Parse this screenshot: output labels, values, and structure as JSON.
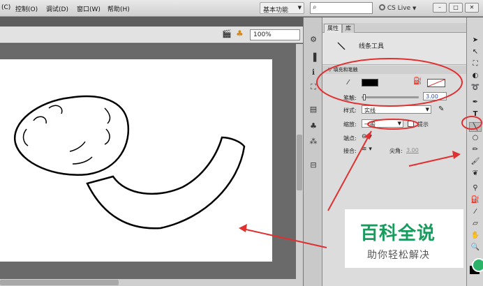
{
  "menubar": {
    "items": [
      "(C)",
      "控制(O)",
      "调试(D)",
      "窗口(W)",
      "帮助(H)"
    ],
    "workspace_label": "基本功能",
    "search_icon": "search-icon",
    "cslive_label": "CS Live",
    "win_buttons": [
      "–",
      "□",
      "✕"
    ]
  },
  "scene": {
    "zoom": "100%"
  },
  "properties": {
    "tabs": [
      "属性",
      "库"
    ],
    "tool_name": "线条工具",
    "section_title": "填充和笔触",
    "stroke_label": "笔触:",
    "stroke_value": "3.00",
    "style_label": "样式:",
    "style_value": "实线",
    "scale_label": "缩放:",
    "scale_value": "一般",
    "hint_label": "提示",
    "cap_label": "端点:",
    "join_label": "接合:",
    "miter_label": "尖角:",
    "miter_value": "3.00"
  },
  "colors": {
    "stroke_color": "#000000",
    "fill_color": "none",
    "annotation": "#e03030",
    "watermark": "#1a9b5e"
  },
  "watermark": {
    "title": "百科全说",
    "subtitle": "助你轻松解决"
  }
}
